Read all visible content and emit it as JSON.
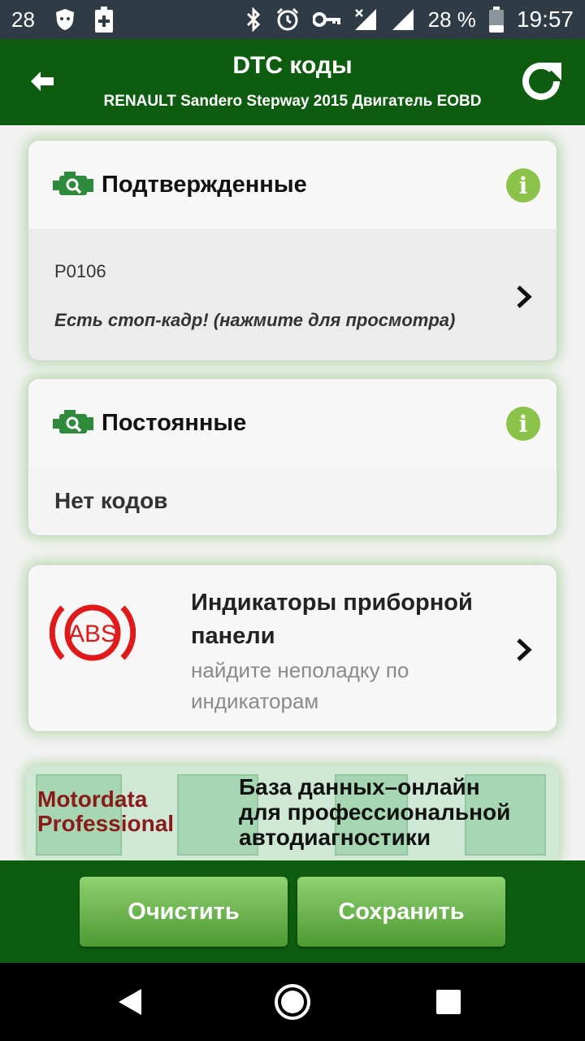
{
  "status_bar": {
    "notification_count": "28",
    "battery_percent": "28 %",
    "time": "19:57"
  },
  "app_bar": {
    "title": "DTC коды",
    "subtitle": "RENAULT Sandero Stepway 2015 Двигатель EOBD"
  },
  "confirmed_card": {
    "title": "Подтвержденные",
    "code": "P0106",
    "freeze_frame_note": "Есть стоп-кадр! (нажмите для просмотра)"
  },
  "permanent_card": {
    "title": "Постоянные",
    "empty_text": "Нет кодов"
  },
  "indicators_card": {
    "icon_text": "ABS",
    "title": "Индикаторы приборной панели",
    "subtitle": "найдите неполадку по индикаторам"
  },
  "banner": {
    "logo_line1": "Motordata",
    "logo_line2": "Professional",
    "text_line1": "База данных–онлайн",
    "text_line2": "для профессиональной",
    "text_line3": "автодиагностики"
  },
  "actions": {
    "clear_label": "Очистить",
    "save_label": "Сохранить"
  },
  "colors": {
    "app_bar": "#0d5c10",
    "button_gradient_top": "#8fd16f",
    "info_icon": "#8bc34a",
    "abs_red": "#e0191b"
  },
  "icons": {
    "back": "arrow-left-icon",
    "refresh": "refresh-icon",
    "engine": "check-engine-icon",
    "info": "info-icon",
    "chevron": "chevron-right-icon"
  }
}
